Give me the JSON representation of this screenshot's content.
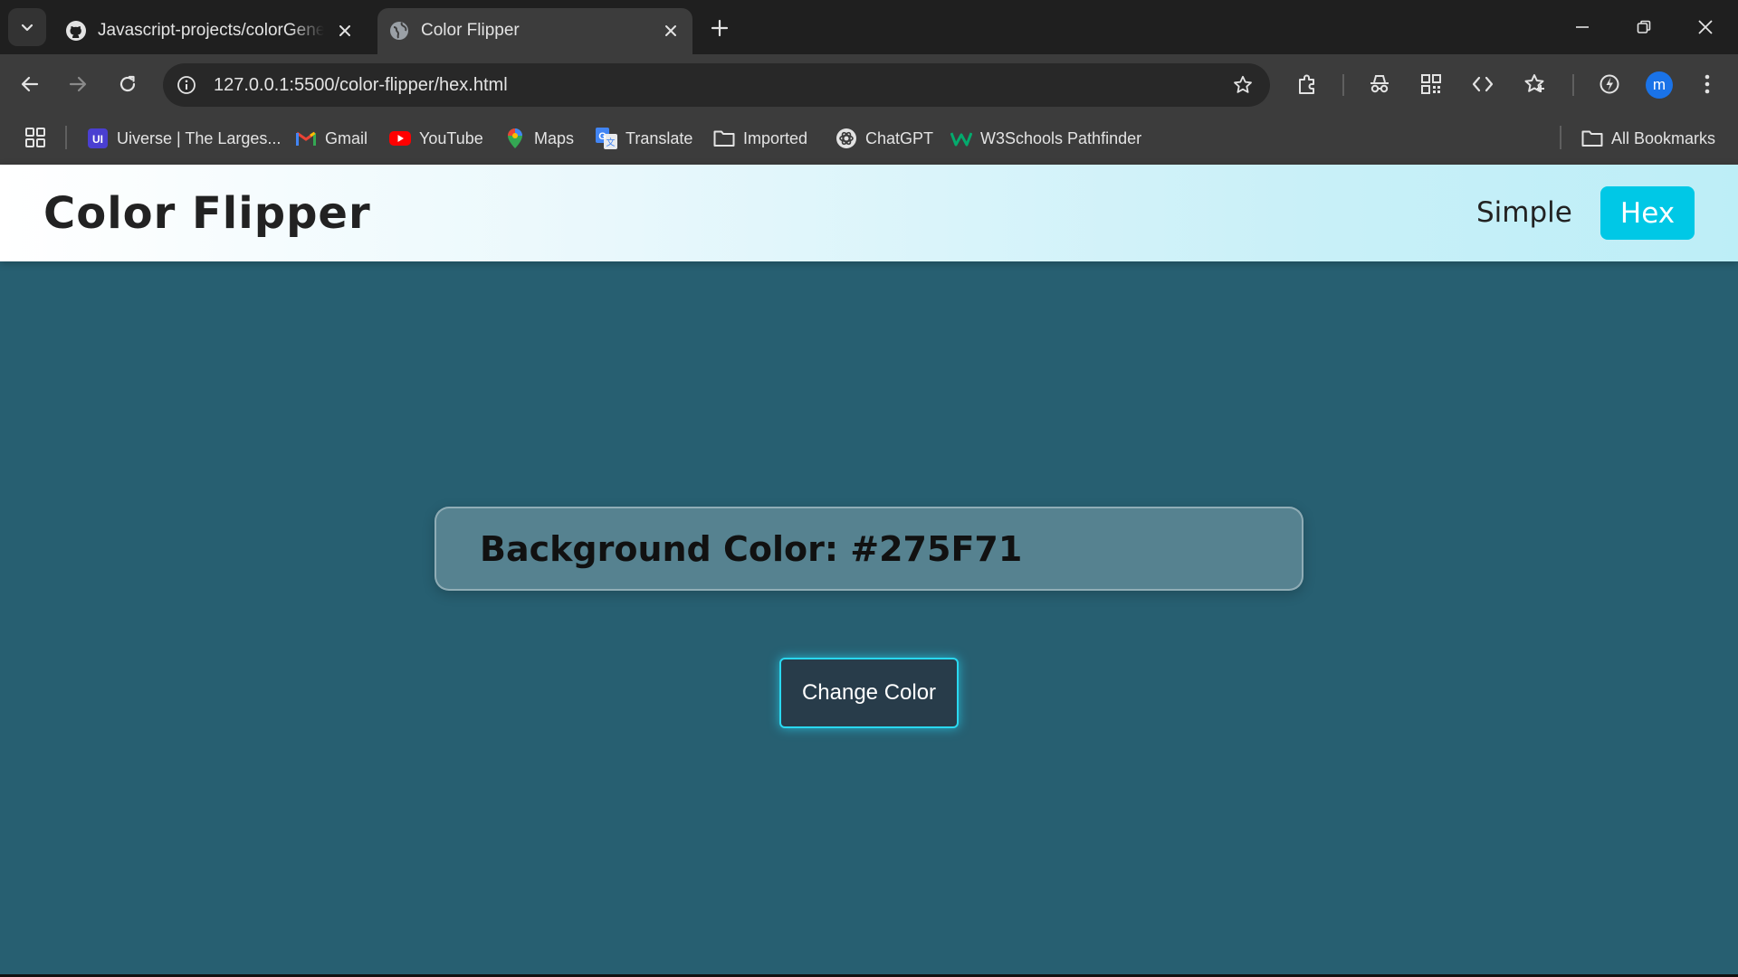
{
  "browser": {
    "tabs": [
      {
        "title": "Javascript-projects/colorGenera",
        "favicon": "github-icon",
        "active": false
      },
      {
        "title": "Color Flipper",
        "favicon": "globe-icon",
        "active": true
      }
    ],
    "address": "127.0.0.1:5500/color-flipper/hex.html",
    "profile_initial": "m",
    "bookmarks": [
      {
        "label": "Uiverse | The Larges...",
        "icon": "uiverse-icon"
      },
      {
        "label": "Gmail",
        "icon": "gmail-icon"
      },
      {
        "label": "YouTube",
        "icon": "youtube-icon"
      },
      {
        "label": "Maps",
        "icon": "maps-icon"
      },
      {
        "label": "Translate",
        "icon": "translate-icon"
      },
      {
        "label": "Imported",
        "icon": "folder-icon"
      },
      {
        "label": "ChatGPT",
        "icon": "chatgpt-icon"
      },
      {
        "label": "W3Schools Pathfinder",
        "icon": "w3schools-icon"
      }
    ],
    "all_bookmarks": "All Bookmarks"
  },
  "page": {
    "brand": "Color Flipper",
    "nav": {
      "simple": "Simple",
      "hex": "Hex"
    },
    "color_label": "Background Color: #275F71",
    "background_color": "#275F71",
    "change_button": "Change Color"
  },
  "colors": {
    "accent": "#00C8E6",
    "button_bg": "#283C4A",
    "button_border": "#2AD8F0"
  }
}
